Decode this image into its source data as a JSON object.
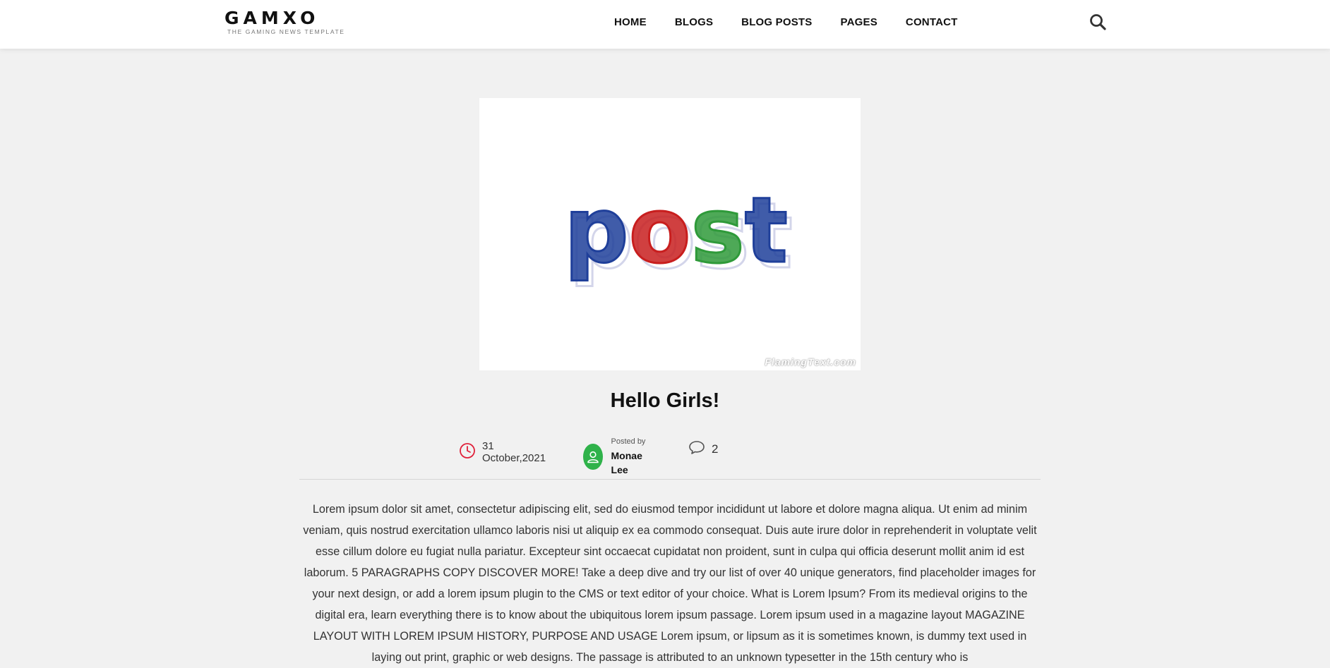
{
  "header": {
    "logo_text": "GAMXO",
    "logo_tagline": "THE GAMING NEWS TEMPLATE",
    "nav": [
      "HOME",
      "BLOGS",
      "BLOG POSTS",
      "PAGES",
      "CONTACT"
    ],
    "search_icon": "search-icon"
  },
  "post": {
    "image_word": "post",
    "image_letter_colors": [
      "#1f3f9a",
      "#c81e1e",
      "#2f9a3a",
      "#1f3f9a"
    ],
    "image_watermark": "FlamingText.com",
    "title": "Hello Girls!",
    "date": "31 October,2021",
    "posted_by_label": "Posted by",
    "author": "Monae Lee",
    "comments_count": "2",
    "body": "Lorem ipsum dolor sit amet, consectetur adipiscing elit, sed do eiusmod tempor incididunt ut labore et dolore magna aliqua. Ut enim ad minim veniam, quis nostrud exercitation ullamco laboris nisi ut aliquip ex ea commodo consequat. Duis aute irure dolor in reprehenderit in voluptate velit esse cillum dolore eu fugiat nulla pariatur. Excepteur sint occaecat cupidatat non proident, sunt in culpa qui officia deserunt mollit anim id est laborum. 5 PARAGRAPHS COPY DISCOVER MORE! Take a deep dive and try our list of over 40 unique generators, find placeholder images for your next design, or add a lorem ipsum plugin to the CMS or text editor of your choice. What is Lorem Ipsum? From its medieval origins to the digital era, learn everything there is to know about the ubiquitous lorem ipsum passage. Lorem ipsum used in a magazine layout MAGAZINE LAYOUT WITH LOREM IPSUM HISTORY, PURPOSE AND USAGE Lorem ipsum, or lipsum as it is sometimes known, is dummy text used in laying out print, graphic or web designs. The passage is attributed to an unknown typesetter in the 15th century who is"
  },
  "colors": {
    "accent_red": "#e0203a",
    "avatar_green": "#2fb24a"
  }
}
